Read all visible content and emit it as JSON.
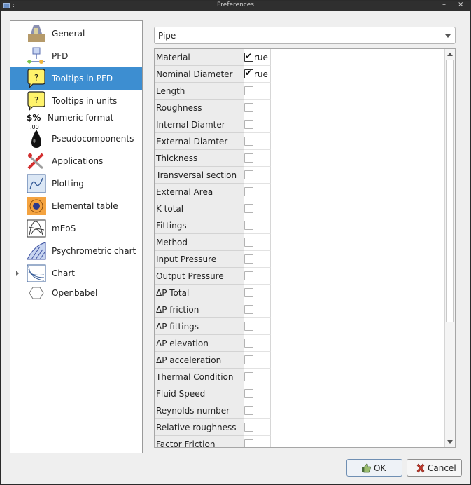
{
  "window": {
    "title": "Preferences",
    "controls": [
      "–",
      "×"
    ]
  },
  "sidebar": {
    "items": [
      {
        "label": "General",
        "icon": "general-icon",
        "selected": false
      },
      {
        "label": "PFD",
        "icon": "pfd-icon",
        "selected": false
      },
      {
        "label": "Tooltips in PFD",
        "icon": "tooltip-icon",
        "selected": true
      },
      {
        "label": "Tooltips in units",
        "icon": "tooltip-icon",
        "selected": false
      },
      {
        "label": "Numeric format",
        "icon": "numeric-format-icon",
        "selected": false
      },
      {
        "label": "Pseudocomponents",
        "icon": "oil-drop-icon",
        "selected": false
      },
      {
        "label": "Applications",
        "icon": "applications-icon",
        "selected": false
      },
      {
        "label": "Plotting",
        "icon": "plotting-icon",
        "selected": false
      },
      {
        "label": "Elemental table",
        "icon": "elemental-table-icon",
        "selected": false
      },
      {
        "label": "mEoS",
        "icon": "meos-icon",
        "selected": false
      },
      {
        "label": "Psychrometric chart",
        "icon": "psychrometric-chart-icon",
        "selected": false
      },
      {
        "label": "Chart",
        "icon": "chart-icon",
        "selected": false
      },
      {
        "label": "Openbabel",
        "icon": "openbabel-icon",
        "selected": false
      }
    ]
  },
  "combo": {
    "value": "Pipe"
  },
  "table": {
    "rows": [
      {
        "label": "Material",
        "checked": true,
        "text": "rue"
      },
      {
        "label": "Nominal Diameter",
        "checked": true,
        "text": "rue"
      },
      {
        "label": "Length",
        "checked": false,
        "text": ""
      },
      {
        "label": "Roughness",
        "checked": false,
        "text": ""
      },
      {
        "label": "Internal Diamter",
        "checked": false,
        "text": ""
      },
      {
        "label": "External Diamter",
        "checked": false,
        "text": ""
      },
      {
        "label": "Thickness",
        "checked": false,
        "text": ""
      },
      {
        "label": "Transversal section",
        "checked": false,
        "text": ""
      },
      {
        "label": "External Area",
        "checked": false,
        "text": ""
      },
      {
        "label": "K total",
        "checked": false,
        "text": ""
      },
      {
        "label": "Fittings",
        "checked": false,
        "text": ""
      },
      {
        "label": "Method",
        "checked": false,
        "text": ""
      },
      {
        "label": "Input Pressure",
        "checked": false,
        "text": ""
      },
      {
        "label": "Output Pressure",
        "checked": false,
        "text": ""
      },
      {
        "label": "ΔP Total",
        "checked": false,
        "text": ""
      },
      {
        "label": "ΔP friction",
        "checked": false,
        "text": ""
      },
      {
        "label": "ΔP fittings",
        "checked": false,
        "text": ""
      },
      {
        "label": "ΔP elevation",
        "checked": false,
        "text": ""
      },
      {
        "label": "ΔP acceleration",
        "checked": false,
        "text": ""
      },
      {
        "label": "Thermal Condition",
        "checked": false,
        "text": ""
      },
      {
        "label": "Fluid Speed",
        "checked": false,
        "text": ""
      },
      {
        "label": "Reynolds number",
        "checked": false,
        "text": ""
      },
      {
        "label": "Relative roughness",
        "checked": false,
        "text": ""
      },
      {
        "label": "Factor Friction",
        "checked": false,
        "text": ""
      }
    ]
  },
  "buttons": {
    "ok": "OK",
    "cancel": "Cancel"
  }
}
